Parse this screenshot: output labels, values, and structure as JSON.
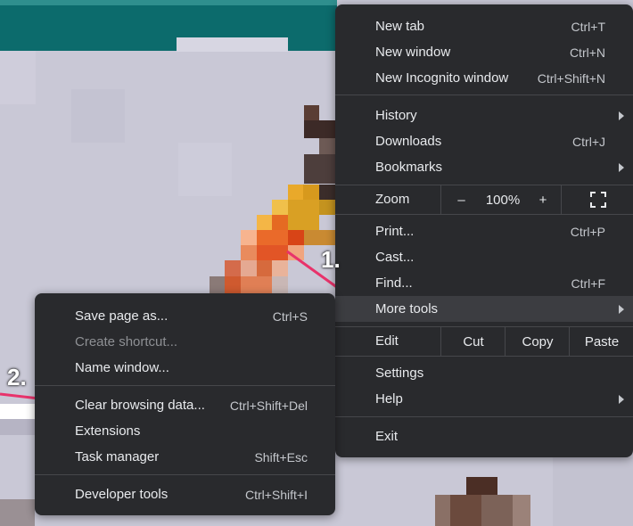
{
  "annotations": {
    "step1": "1.",
    "step2": "2."
  },
  "main_menu": {
    "new_tab": {
      "label": "New tab",
      "shortcut": "Ctrl+T"
    },
    "new_window": {
      "label": "New window",
      "shortcut": "Ctrl+N"
    },
    "new_incognito": {
      "label": "New Incognito window",
      "shortcut": "Ctrl+Shift+N"
    },
    "history": {
      "label": "History"
    },
    "downloads": {
      "label": "Downloads",
      "shortcut": "Ctrl+J"
    },
    "bookmarks": {
      "label": "Bookmarks"
    },
    "zoom": {
      "label": "Zoom",
      "minus": "–",
      "level": "100%",
      "plus": "+"
    },
    "print": {
      "label": "Print...",
      "shortcut": "Ctrl+P"
    },
    "cast": {
      "label": "Cast..."
    },
    "find": {
      "label": "Find...",
      "shortcut": "Ctrl+F"
    },
    "more_tools": {
      "label": "More tools"
    },
    "edit": {
      "label": "Edit",
      "cut": "Cut",
      "copy": "Copy",
      "paste": "Paste"
    },
    "settings": {
      "label": "Settings"
    },
    "help": {
      "label": "Help"
    },
    "exit": {
      "label": "Exit"
    }
  },
  "sub_menu": {
    "save_page": {
      "label": "Save page as...",
      "shortcut": "Ctrl+S"
    },
    "create_shortcut": {
      "label": "Create shortcut..."
    },
    "name_window": {
      "label": "Name window..."
    },
    "clear_browsing": {
      "label": "Clear browsing data...",
      "shortcut": "Ctrl+Shift+Del"
    },
    "extensions": {
      "label": "Extensions"
    },
    "task_manager": {
      "label": "Task manager",
      "shortcut": "Shift+Esc"
    },
    "developer_tools": {
      "label": "Developer tools",
      "shortcut": "Ctrl+Shift+I"
    }
  },
  "colors": {
    "menu_bg": "#292a2d",
    "highlight": "#3c3d41",
    "annotation_arrow": "#e8336b",
    "teal_bar": "#0c6b6c"
  }
}
